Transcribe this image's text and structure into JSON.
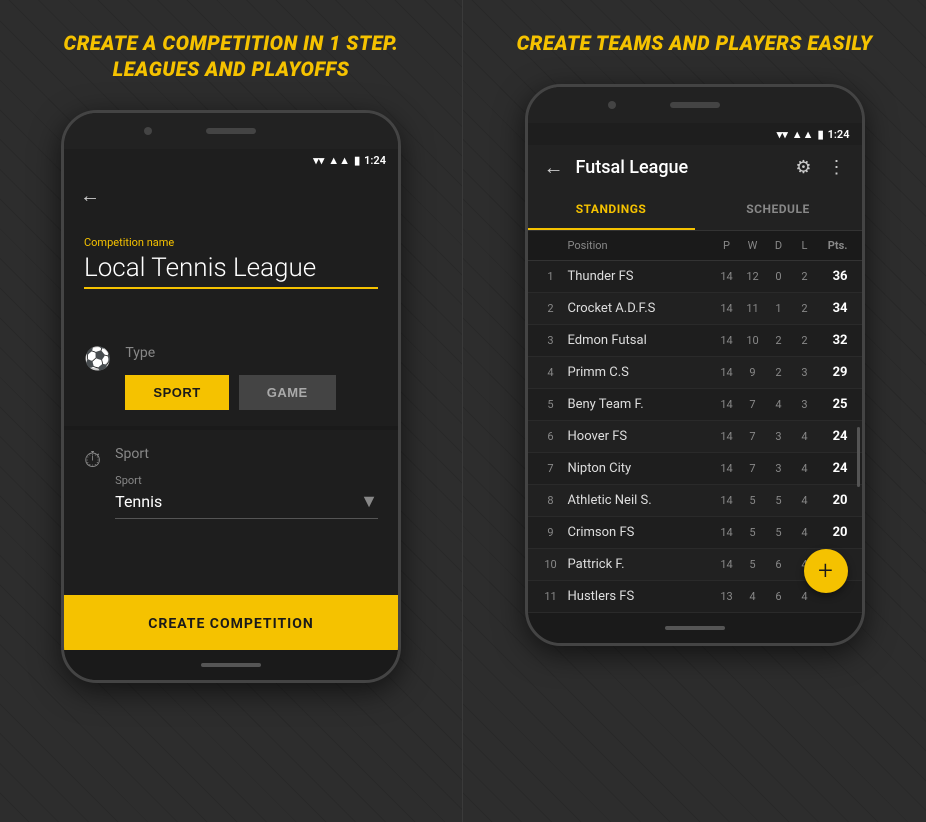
{
  "left": {
    "title": "CREATE A COMPETITION IN 1 STEP.\nLEAGUES AND PLAYOFFS",
    "phone": {
      "status_time": "1:24",
      "back_arrow": "←",
      "competition_name_label": "Competition name",
      "competition_name_value": "Local Tennis League",
      "type_label": "Type",
      "btn_sport": "SPORT",
      "btn_game": "GAME",
      "sport_section_label": "Sport",
      "sport_dropdown_label": "Sport",
      "sport_value": "Tennis",
      "create_btn": "CREATE COMPETITION"
    }
  },
  "right": {
    "title": "CREATE TEAMS AND PLAYERS EASILY",
    "phone": {
      "status_time": "1:24",
      "back_arrow": "←",
      "app_title": "Futsal League",
      "tab_standings": "STANDINGS",
      "tab_schedule": "SCHEDULE",
      "table_headers": [
        "Position",
        "P",
        "W",
        "D",
        "L",
        "Pts."
      ],
      "rows": [
        {
          "pos": 1,
          "team": "Thunder FS",
          "p": 14,
          "w": 12,
          "d": 0,
          "l": 2,
          "pts": 36
        },
        {
          "pos": 2,
          "team": "Crocket A.D.F.S",
          "p": 14,
          "w": 11,
          "d": 1,
          "l": 2,
          "pts": 34
        },
        {
          "pos": 3,
          "team": "Edmon Futsal",
          "p": 14,
          "w": 10,
          "d": 2,
          "l": 2,
          "pts": 32
        },
        {
          "pos": 4,
          "team": "Primm C.S",
          "p": 14,
          "w": 9,
          "d": 2,
          "l": 3,
          "pts": 29
        },
        {
          "pos": 5,
          "team": "Beny Team F.",
          "p": 14,
          "w": 7,
          "d": 4,
          "l": 3,
          "pts": 25
        },
        {
          "pos": 6,
          "team": "Hoover FS",
          "p": 14,
          "w": 7,
          "d": 3,
          "l": 4,
          "pts": 24
        },
        {
          "pos": 7,
          "team": "Nipton City",
          "p": 14,
          "w": 7,
          "d": 3,
          "l": 4,
          "pts": 24
        },
        {
          "pos": 8,
          "team": "Athletic Neil S.",
          "p": 14,
          "w": 5,
          "d": 5,
          "l": 4,
          "pts": 20
        },
        {
          "pos": 9,
          "team": "Crimson FS",
          "p": 14,
          "w": 5,
          "d": 5,
          "l": 4,
          "pts": 20
        },
        {
          "pos": 10,
          "team": "Pattrick F.",
          "p": 14,
          "w": 5,
          "d": 6,
          "l": 4,
          "pts": ""
        },
        {
          "pos": 11,
          "team": "Hustlers FS",
          "p": 13,
          "w": 4,
          "d": 6,
          "l": 4,
          "pts": ""
        }
      ],
      "fab_icon": "+"
    }
  }
}
